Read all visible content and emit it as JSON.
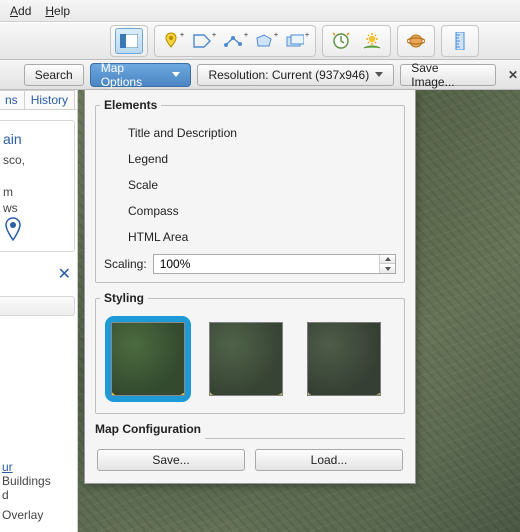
{
  "menu": {
    "add": "Add",
    "help": "Help"
  },
  "toolbar": {
    "icons": {
      "panel": "panel-icon",
      "pin": "pin-icon",
      "tag": "tag-icon",
      "path": "path-icon",
      "polygon": "polygon-icon",
      "overlay": "overlay-icon",
      "time": "time-icon",
      "sun": "sun-icon",
      "planet": "planet-icon",
      "ruler": "ruler-icon"
    }
  },
  "options": {
    "search_btn": "Search",
    "map_options_btn": "Map Options",
    "resolution_label": "Resolution: Current (937x946)",
    "save_image_btn": "Save Image...",
    "close": "✕"
  },
  "dropdown": {
    "elements": {
      "legend_title": "Elements",
      "items": [
        "Title and Description",
        "Legend",
        "Scale",
        "Compass",
        "HTML Area"
      ],
      "scaling_label": "Scaling:",
      "scaling_value": "100%"
    },
    "styling": {
      "legend_title": "Styling"
    },
    "config": {
      "title": "Map Configuration",
      "save": "Save...",
      "load": "Load..."
    }
  },
  "left": {
    "tabs": {
      "ns": "ns",
      "history": "History"
    },
    "card": {
      "title": "ain",
      "line1": "sco,",
      "line2a": "m",
      "line2b": "ws"
    },
    "close": "✕",
    "foot": {
      "link": "ur",
      "l1": "Buildings",
      "l2": "d",
      "l3": " Overlay"
    }
  }
}
